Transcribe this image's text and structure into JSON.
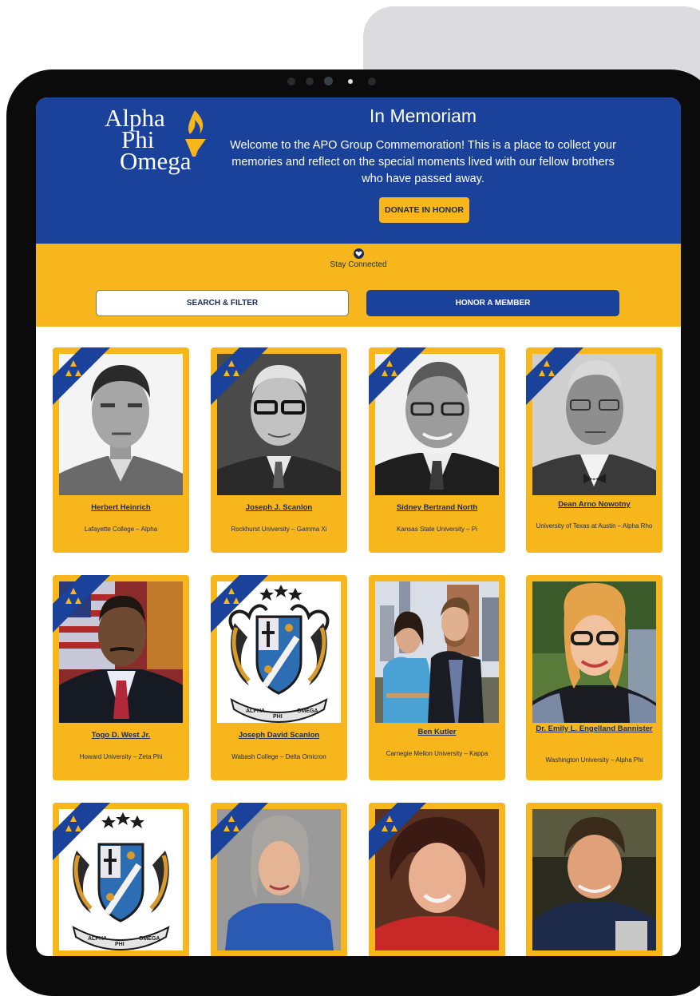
{
  "hero": {
    "logo_lines": [
      "Alpha",
      "Phi",
      "Omega"
    ],
    "title": "In Memoriam",
    "subtitle": "Welcome to the APO Group Commemoration! This is a place to collect your memories and reflect on the special moments lived with our fellow brothers who have passed away.",
    "donate_label": "DONATE IN HONOR"
  },
  "band": {
    "stay_label": "Stay Connected",
    "search_label": "SEARCH & FILTER",
    "honor_label": "HONOR A MEMBER"
  },
  "members": [
    {
      "name": "Herbert Heinrich",
      "school": "Lafayette College – Alpha"
    },
    {
      "name": "Joseph J. Scanlon",
      "school": "Rockhurst University – Gamma Xi"
    },
    {
      "name": "Sidney Bertrand North",
      "school": "Kansas State University – Pi"
    },
    {
      "name": "Dean Arno Nowotny",
      "school": "University of Texas at Austin – Alpha Rho"
    },
    {
      "name": "Togo D. West Jr.",
      "school": "Howard University – Zeta Phi"
    },
    {
      "name": "Joseph David Scanlon",
      "school": "Wabash College – Delta Omicron"
    },
    {
      "name": "Ben Kutler",
      "school": "Carnegie Mellon University – Kappa"
    },
    {
      "name": "Dr. Emily L. Engelland Bannister",
      "school": "Washington University – Alpha Phi"
    }
  ],
  "crest_banner": {
    "left": "ALPHA",
    "center": "PHI",
    "right": "OMEGA"
  },
  "colors": {
    "brand_blue": "#1a429a",
    "brand_gold": "#f7b71c",
    "text_navy": "#1b2a55"
  }
}
